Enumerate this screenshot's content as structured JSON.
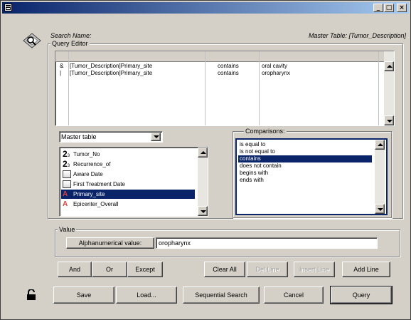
{
  "window": {
    "title": ""
  },
  "header": {
    "search_name_label": "Search Name:",
    "master_table_label": "Master Table: [Tumor_Description]"
  },
  "query_editor": {
    "title": "Query Editor",
    "rows": [
      {
        "op": "&",
        "field": "[Tumor_Description]Primary_site",
        "comparison": "contains",
        "value": "oral cavity"
      },
      {
        "op": "|",
        "field": "[Tumor_Description]Primary_site",
        "comparison": "contains",
        "value": "oropharynx"
      }
    ]
  },
  "master_table": {
    "selected": "Master table",
    "fields": [
      {
        "label": "Tumor_No",
        "icon": "numeric-icon"
      },
      {
        "label": "Recurrence_of",
        "icon": "numeric-icon"
      },
      {
        "label": "Aware Date",
        "icon": "date-icon"
      },
      {
        "label": "First Treatment Date",
        "icon": "date-icon"
      },
      {
        "label": "Primary_site",
        "icon": "text-icon"
      },
      {
        "label": "Epicenter_Overall",
        "icon": "text-icon"
      }
    ],
    "selected_index": 4
  },
  "comparisons": {
    "title": "Comparisons:",
    "items": [
      "is equal to",
      "is not equal to",
      "contains",
      "does not contain",
      "begins with",
      "ends with"
    ],
    "selected_index": 2
  },
  "value": {
    "title": "Value",
    "label": "Alphanumerical value:",
    "input": "oropharynx"
  },
  "logic_buttons": {
    "and": "And",
    "or": "Or",
    "except": "Except"
  },
  "line_buttons": {
    "clear_all": "Clear All",
    "del_line": "Del Line",
    "insert_line": "Insert Line",
    "add_line": "Add Line"
  },
  "bottom_buttons": {
    "save": "Save",
    "load": "Load...",
    "sequential": "Sequential Search",
    "cancel": "Cancel",
    "query": "Query"
  }
}
